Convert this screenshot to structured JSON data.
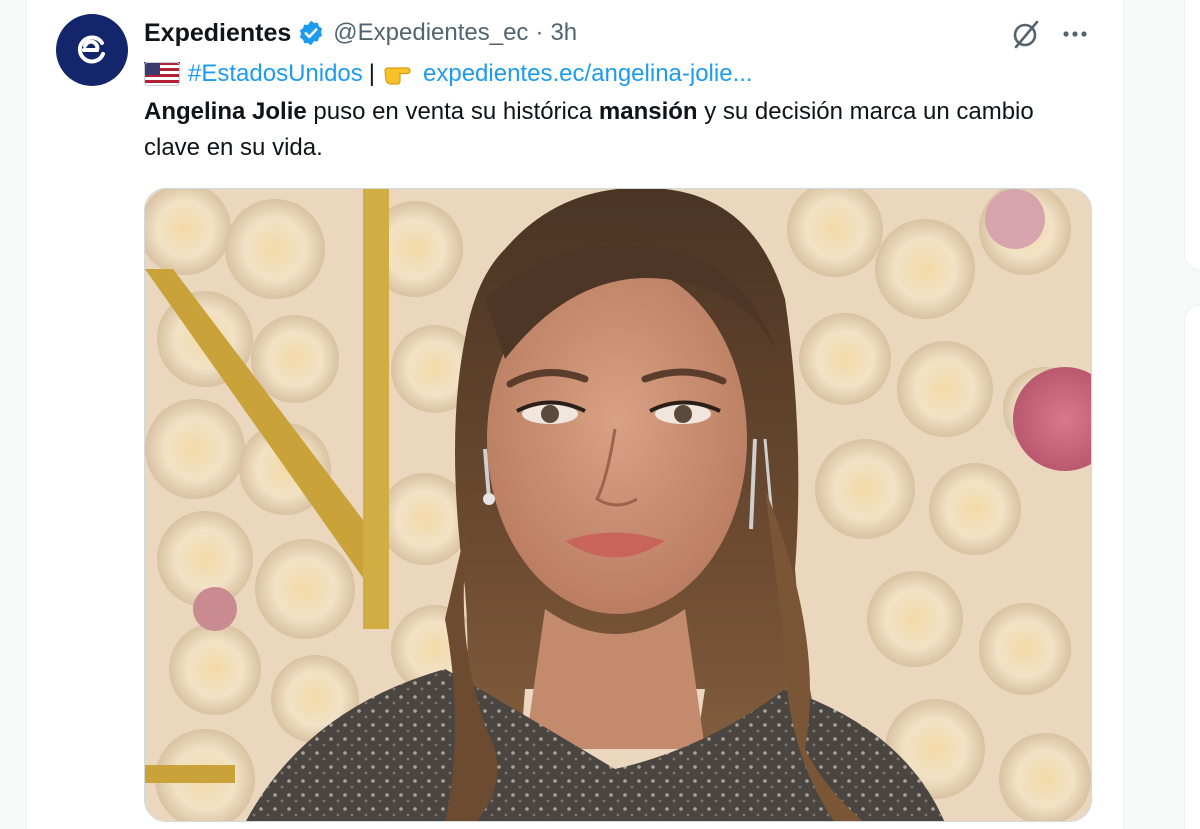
{
  "tweet": {
    "display_name": "Expedientes",
    "handle": "@Expedientes_ec",
    "separator": "·",
    "time": "3h",
    "hashtag": "#EstadosUnidos",
    "divider": "|",
    "link": "expedientes.ec/angelina-jolie...",
    "text_parts": {
      "bold1": "Angelina Jolie",
      "mid": " puso en venta su histórica ",
      "bold2": "mansión",
      "end": " y su decisión marca un cambio clave en su vida."
    },
    "icons": {
      "avatar": "expedientes-logo",
      "verified": "verified-badge-icon",
      "grok": "grok-icon",
      "more": "more-icon",
      "flag": "us-flag-icon",
      "pointing": "pointing-hand-icon"
    }
  },
  "colors": {
    "link": "#1d9bf0",
    "avatar_bg": "#13256b",
    "text": "#0f1419",
    "secondary": "#536471"
  }
}
